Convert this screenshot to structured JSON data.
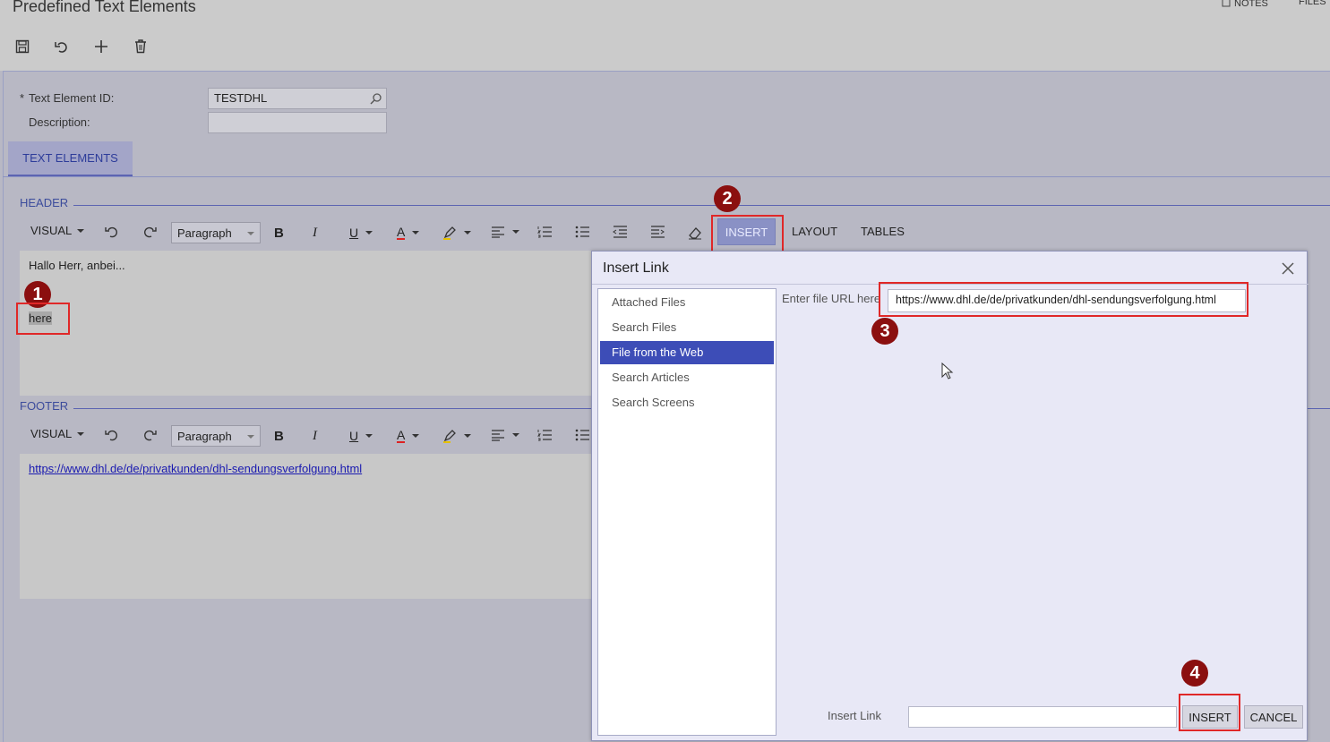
{
  "page": {
    "title": "Predefined Text Elements",
    "notes_label": "NOTES",
    "files_label": "FILES"
  },
  "form": {
    "text_element_id_label": "Text Element ID:",
    "required_mark": "*",
    "text_element_id_value": "TESTDHL",
    "description_label": "Description:",
    "description_value": ""
  },
  "tabs": [
    {
      "label": "TEXT ELEMENTS",
      "active": true
    }
  ],
  "header_section": {
    "label": "HEADER",
    "toolbar": {
      "mode": "VISUAL",
      "paragraph": "Paragraph",
      "insert": "INSERT",
      "layout": "LAYOUT",
      "tables": "TABLES"
    },
    "content_line1": "Hallo Herr, anbei...",
    "content_selected": "here"
  },
  "footer_section": {
    "label": "FOOTER",
    "toolbar": {
      "mode": "VISUAL",
      "paragraph": "Paragraph"
    },
    "link": "https://www.dhl.de/de/privatkunden/dhl-sendungsverfolgung.html"
  },
  "dialog": {
    "title": "Insert Link",
    "sources": [
      {
        "label": "Attached Files",
        "active": false
      },
      {
        "label": "Search Files",
        "active": false
      },
      {
        "label": "File from the Web",
        "active": true
      },
      {
        "label": "Search Articles",
        "active": false
      },
      {
        "label": "Search Screens",
        "active": false
      }
    ],
    "url_label": "Enter file URL here",
    "url_value": "https://www.dhl.de/de/privatkunden/dhl-sendungsverfolgung.html",
    "insert_link_label": "Insert Link",
    "insert_link_value": "",
    "insert_button": "INSERT",
    "cancel_button": "CANCEL"
  },
  "annotations": [
    "1",
    "2",
    "3",
    "4"
  ],
  "colors": {
    "accent": "#3d4db7",
    "annotation": "#8b0f0f",
    "highlight_box": "#e02828"
  }
}
